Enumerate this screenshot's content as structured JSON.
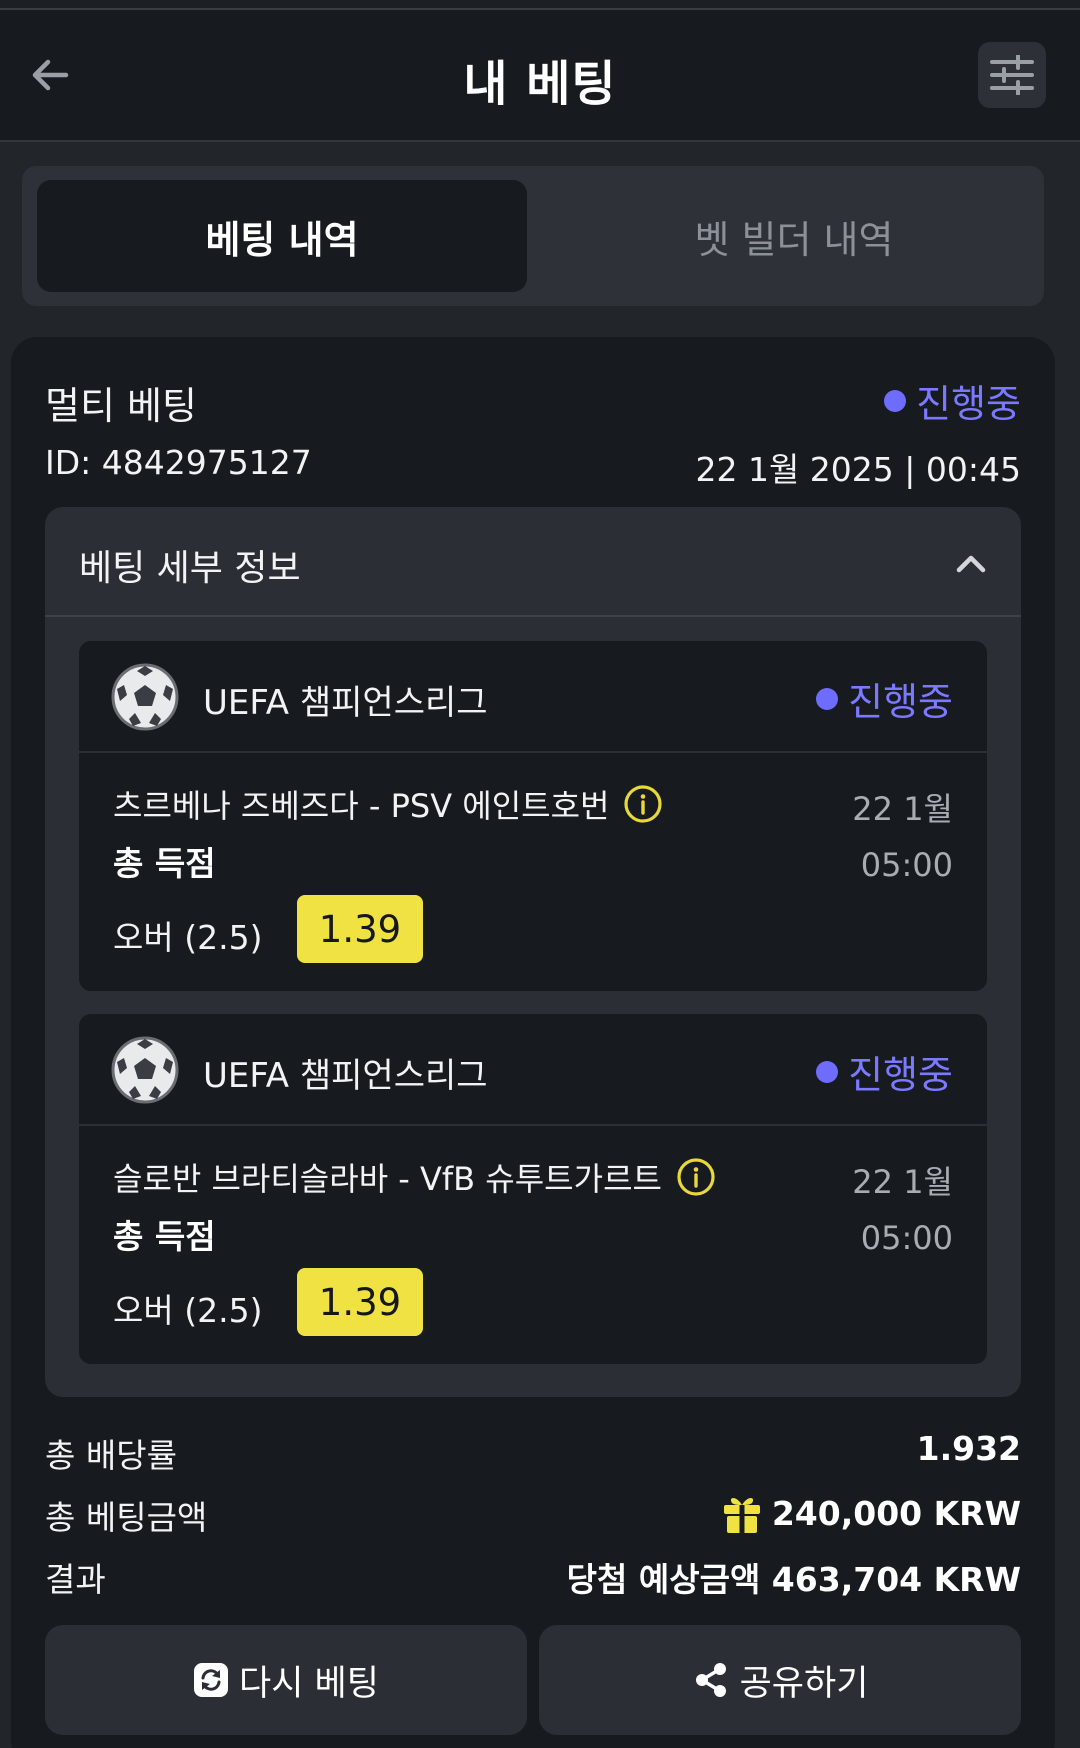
{
  "header": {
    "title": "내 베팅",
    "back_icon": "arrow-left-icon",
    "filter_icon": "sliders-icon"
  },
  "tabs": [
    {
      "label": "베팅 내역",
      "active": true
    },
    {
      "label": "벳 빌더 내역",
      "active": false
    }
  ],
  "bet": {
    "type": "멀티 베팅",
    "status": "진행중",
    "id": "ID: 4842975127",
    "datetime": "22 1월 2025 | 00:45",
    "details_title": "베팅 세부 정보",
    "legs": [
      {
        "league": "UEFA 챔피언스리그",
        "status": "진행중",
        "match": "츠르베나 즈베즈다 - PSV 에인트호번",
        "date": "22 1월",
        "time": "05:00",
        "market": "총 득점",
        "selection": "오버 (2.5)",
        "odds": "1.39"
      },
      {
        "league": "UEFA 챔피언스리그",
        "status": "진행중",
        "match": "슬로반 브라티슬라바 - VfB 슈투트가르트",
        "date": "22 1월",
        "time": "05:00",
        "market": "총 득점",
        "selection": "오버 (2.5)",
        "odds": "1.39"
      }
    ],
    "summary": {
      "total_odds_label": "총 배당률",
      "total_odds": "1.932",
      "total_stake_label": "총 베팅금액",
      "total_stake": "240,000 KRW",
      "result_label": "결과",
      "result_value": "당첨 예상금액 463,704 KRW"
    }
  },
  "actions": {
    "rebet_label": "다시 베팅",
    "share_label": "공유하기"
  },
  "colors": {
    "accent_status": "#7b79ff",
    "odds_badge": "#f0e243",
    "info_icon": "#e8d83a"
  }
}
